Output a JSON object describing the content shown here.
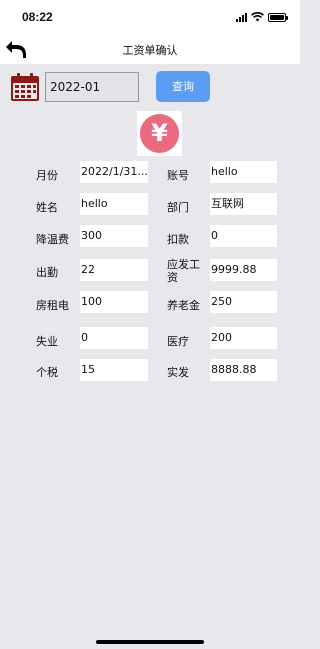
{
  "status": {
    "time": "08:22"
  },
  "nav": {
    "title": "工资单确认"
  },
  "search": {
    "value": "2022-01",
    "button_label": "查询"
  },
  "icons": {
    "back": "back-arrow-icon",
    "calendar": "calendar-icon",
    "currency": "yen-icon"
  },
  "colors": {
    "query_button": "#5b9cf5",
    "yen_circle": "#ec6a7f",
    "calendar": "#8b1a1a"
  },
  "fields": {
    "month": {
      "label": "月份",
      "value": "2022/1/31..."
    },
    "account": {
      "label": "账号",
      "value": "hello"
    },
    "name": {
      "label": "姓名",
      "value": "hello"
    },
    "dept": {
      "label": "部门",
      "value": "互联网"
    },
    "cooling": {
      "label": "降温费",
      "value": "300"
    },
    "deduction": {
      "label": "扣款",
      "value": "0"
    },
    "attendance": {
      "label": "出勤",
      "value": "22"
    },
    "gross": {
      "label": "应发工资",
      "value": "9999.88"
    },
    "rent": {
      "label": "房租电",
      "value": "100"
    },
    "pension": {
      "label": "养老金",
      "value": "250"
    },
    "unemploy": {
      "label": "失业",
      "value": "0"
    },
    "medical": {
      "label": "医疗",
      "value": "200"
    },
    "tax": {
      "label": "个税",
      "value": "15"
    },
    "net": {
      "label": "实发",
      "value": "8888.88"
    }
  }
}
